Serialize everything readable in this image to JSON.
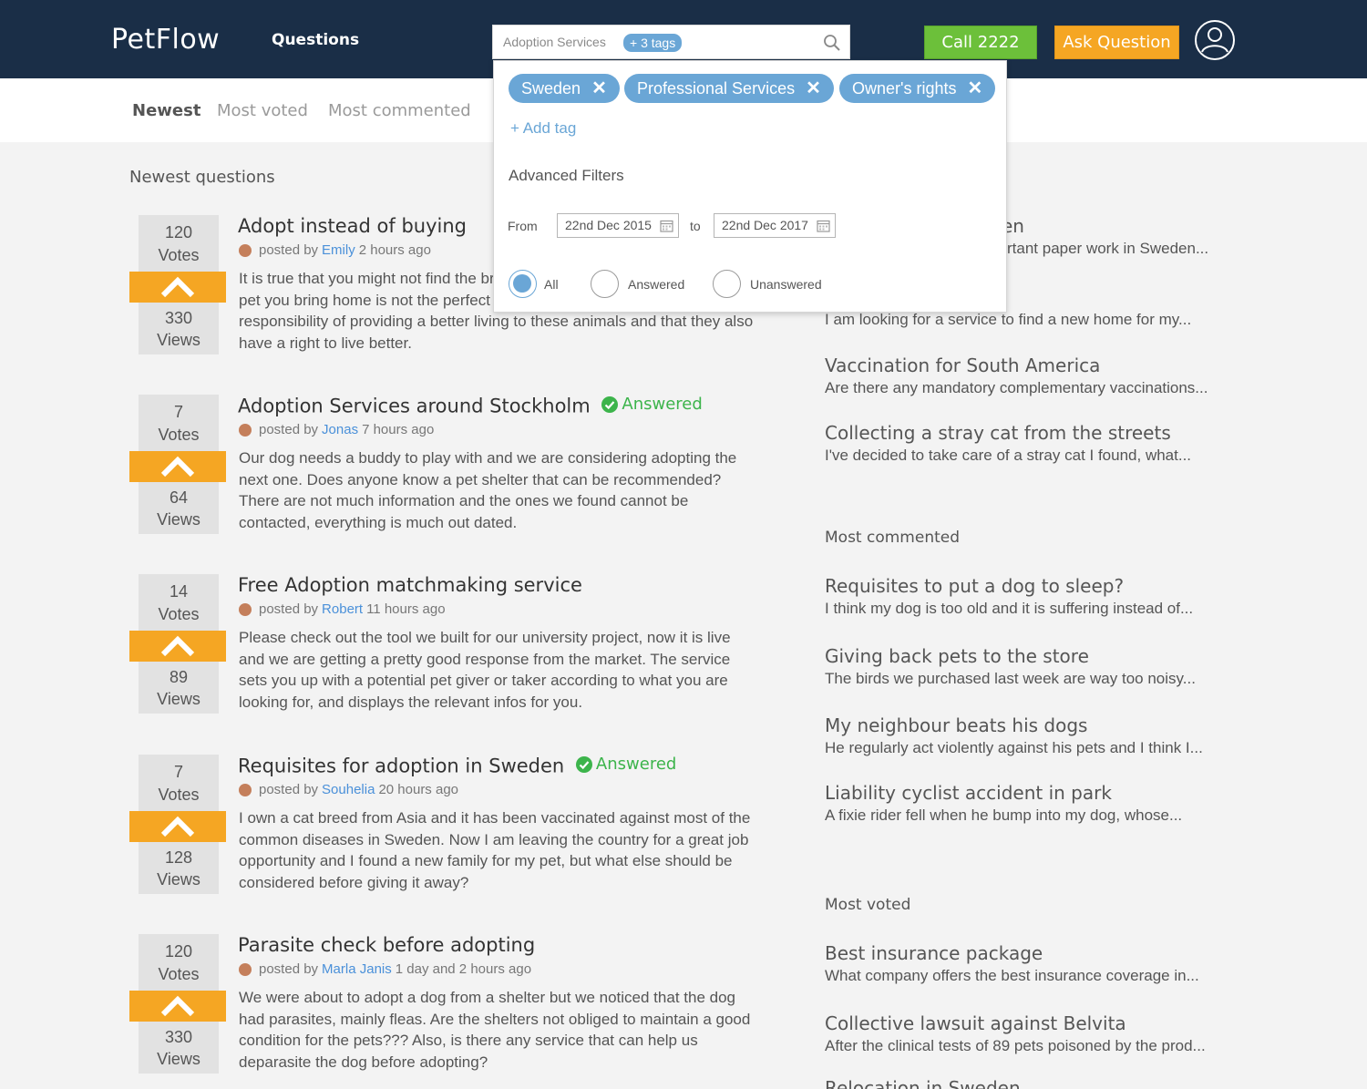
{
  "header": {
    "logo": "PetFlow",
    "nav_questions": "Questions",
    "search_text": "Adoption Services",
    "search_tag_count": "+ 3 tags",
    "call_button": "Call 2222",
    "ask_button": "Ask Question"
  },
  "subnav": {
    "items": [
      "Newest",
      "Most voted",
      "Most commented"
    ]
  },
  "main": {
    "section_title": "Newest questions",
    "questions": [
      {
        "votes": "120",
        "votes_label": "Votes",
        "views": "330",
        "views_label": "Views",
        "title": "Adopt instead of buying",
        "answered": "",
        "posted_by": "posted by",
        "author": "Emily",
        "time": "2 hours ago",
        "body": "It is true that you might not find the breed you are looking for and that the pet you bring home is not the perfect one, but let’s not forget that we have a responsibility of providing a better living to these animals and that they also have a right to live better."
      },
      {
        "votes": "7",
        "votes_label": "Votes",
        "views": "64",
        "views_label": "Views",
        "title": "Adoption Services around Stockholm",
        "answered": "Answered",
        "posted_by": "posted by",
        "author": "Jonas",
        "time": "7 hours ago",
        "body": "Our dog needs a buddy to play with and we are considering adopting the next one. Does anyone know a pet shelter that can be recommended? There are not much information and the ones we found cannot be contacted, everything is much out dated."
      },
      {
        "votes": "14",
        "votes_label": "Votes",
        "views": "89",
        "views_label": "Views",
        "title": "Free Adoption matchmaking service",
        "answered": "",
        "posted_by": "posted by",
        "author": "Robert",
        "time": "11 hours ago",
        "body": "Please check out the tool we built for our university project, now it is live and we are getting a pretty good response from the market. The service sets you up with a potential pet giver or taker according to what you are looking for, and displays the relevant infos for you."
      },
      {
        "votes": "7",
        "votes_label": "Votes",
        "views": "128",
        "views_label": "Views",
        "title": "Requisites for adoption in Sweden",
        "answered": "Answered",
        "posted_by": "posted by",
        "author": "Souhelia",
        "time": "20 hours ago",
        "body": "I own a cat breed from Asia and it has been vaccinated against most of the common diseases in Sweden. Now I am leaving the country for a great job opportunity and I found a new family for my pet, but what else should be considered before giving it away?"
      },
      {
        "votes": "120",
        "votes_label": "Votes",
        "views": "330",
        "views_label": "Views",
        "title": "Parasite check before adopting",
        "answered": "",
        "posted_by": "posted by",
        "author": "Marla Janis",
        "time": "1 day and 2 hours ago",
        "body": "We were about to adopt a dog from a shelter but we noticed that the dog had parasites, mainly fleas. Are the shelters not obliged to maintain a good condition for the pets??? Also, is there any service that can help us deparasite the dog before adopting?"
      }
    ]
  },
  "sidebar": {
    "partial_items": [
      {
        "title": "en",
        "excerpt": "rtant paper work in Sweden..."
      },
      {
        "title": "",
        "excerpt": "I am looking for a service to find a new home for my..."
      }
    ],
    "top_items": [
      {
        "title": "Vaccination for South America",
        "excerpt": "Are there any mandatory complementary vaccinations..."
      },
      {
        "title": "Collecting a stray cat from the streets",
        "excerpt": "I've decided to take care of a stray cat I found, what..."
      }
    ],
    "most_commented_title": "Most commented",
    "most_commented": [
      {
        "title": "Requisites to put a dog to sleep?",
        "excerpt": "I think my dog is too old and it is suffering instead of..."
      },
      {
        "title": "Giving back pets to the store",
        "excerpt": "The birds we purchased last week are way too noisy..."
      },
      {
        "title": "My neighbour beats his dogs",
        "excerpt": "He regularly act violently against his pets and I think I..."
      },
      {
        "title": "Liability cyclist accident in park",
        "excerpt": "A fixie rider fell when he bump into my dog, whose..."
      }
    ],
    "most_voted_title": "Most voted",
    "most_voted": [
      {
        "title": "Best insurance package",
        "excerpt": "What company offers the best insurance coverage in..."
      },
      {
        "title": "Collective lawsuit against Belvita",
        "excerpt": "After the clinical tests of 89 pets poisoned by the prod..."
      },
      {
        "title": "Relocation in Sweden",
        "excerpt": ""
      }
    ]
  },
  "filter_dropdown": {
    "tags": [
      "Sweden",
      "Professional Services",
      "Owner's rights"
    ],
    "add_tag": "+ Add tag",
    "advanced_title": "Advanced Filters",
    "from_label": "From",
    "from_date": "22nd Dec 2015",
    "to_label": "to",
    "to_date": "22nd Dec 2017",
    "radio_options": [
      "All",
      "Answered",
      "Unanswered"
    ],
    "selected_option": "All"
  },
  "colors": {
    "header_bg": "#1a2e47",
    "accent_orange": "#f5a623",
    "call_green": "#6cc03a",
    "tag_blue": "#6aa6d6",
    "answered_green": "#3cb44b",
    "link_blue": "#4a90d9"
  }
}
